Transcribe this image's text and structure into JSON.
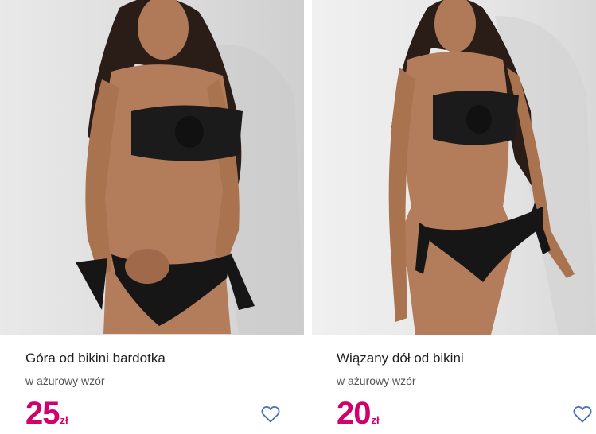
{
  "products": [
    {
      "title": "Góra od bikini bardotka",
      "subtitle": "w ażurowy wzór",
      "price_amount": "25",
      "price_currency": "zł",
      "image_icon": "product-photo",
      "favorite_icon": "heart-icon"
    },
    {
      "title": "Wiązany dół od bikini",
      "subtitle": "w ażurowy wzór",
      "price_amount": "20",
      "price_currency": "zł",
      "image_icon": "product-photo",
      "favorite_icon": "heart-icon"
    }
  ],
  "colors": {
    "price": "#d1006d",
    "heart": "#4a6fb5",
    "title": "#1f1f1f",
    "subtitle": "#555555"
  }
}
